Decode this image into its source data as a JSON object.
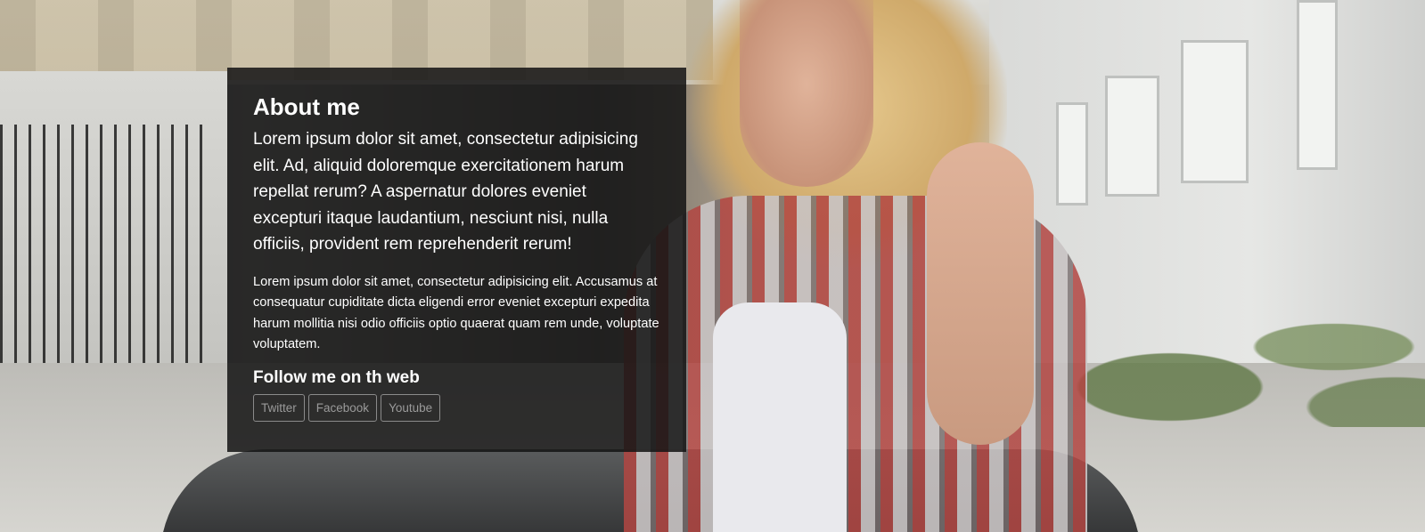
{
  "about": {
    "title": "About me",
    "lead": "Lorem ipsum dolor sit amet, consectetur adipisicing elit. Ad, aliquid doloremque exercitationem harum repellat rerum? A aspernatur dolores eveniet excepturi itaque laudantium, nesciunt nisi, nulla officiis, provident rem reprehenderit rerum!",
    "body": "Lorem ipsum dolor sit amet, consectetur adipisicing elit. Accusamus at consequatur cupiditate dicta eligendi error eveniet excepturi expedita harum mollitia nisi odio officiis optio quaerat quam rem unde, voluptate voluptatem."
  },
  "follow": {
    "title": "Follow me on th web",
    "links": [
      {
        "label": "Twitter",
        "icon": "twitter-link"
      },
      {
        "label": "Facebook",
        "icon": "facebook-link"
      },
      {
        "label": "Youtube",
        "icon": "youtube-link"
      }
    ]
  },
  "colors": {
    "card_background": "#141414",
    "text": "#ffffff",
    "button_border": "#8a8a8a",
    "button_text": "#9a9a9a"
  }
}
